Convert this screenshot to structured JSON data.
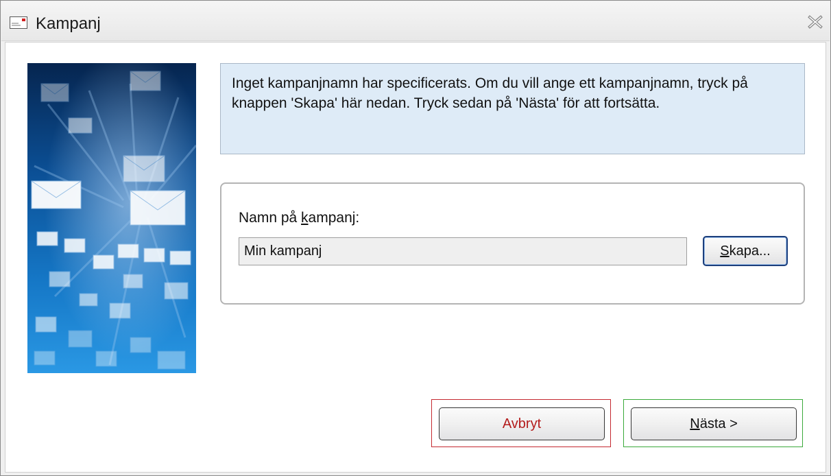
{
  "window": {
    "title": "Kampanj",
    "title_icon": "envelope-icon",
    "close_icon": "close-icon"
  },
  "side_image": {
    "icon": "envelopes-illustration"
  },
  "info": {
    "text": "Inget kampanjnamn har specificerats. Om du vill ange ett kampanjnamn, tryck på knappen 'Skapa' här nedan. Tryck sedan på 'Nästa' för att fortsätta."
  },
  "form": {
    "label_prefix": "Namn på ",
    "label_accel": "k",
    "label_suffix": "ampanj:",
    "name_value": "Min kampanj",
    "create_accel": "S",
    "create_rest": "kapa..."
  },
  "buttons": {
    "cancel_label": "Avbryt",
    "next_accel": "N",
    "next_rest": "ästa >"
  },
  "colors": {
    "info_bg": "#deebf7",
    "cancel_frame": "#c4282f",
    "next_frame": "#3aaa3a",
    "cancel_text": "#b31b1b",
    "image_dark": "#0a2a55",
    "image_light": "#1e8ad8"
  }
}
